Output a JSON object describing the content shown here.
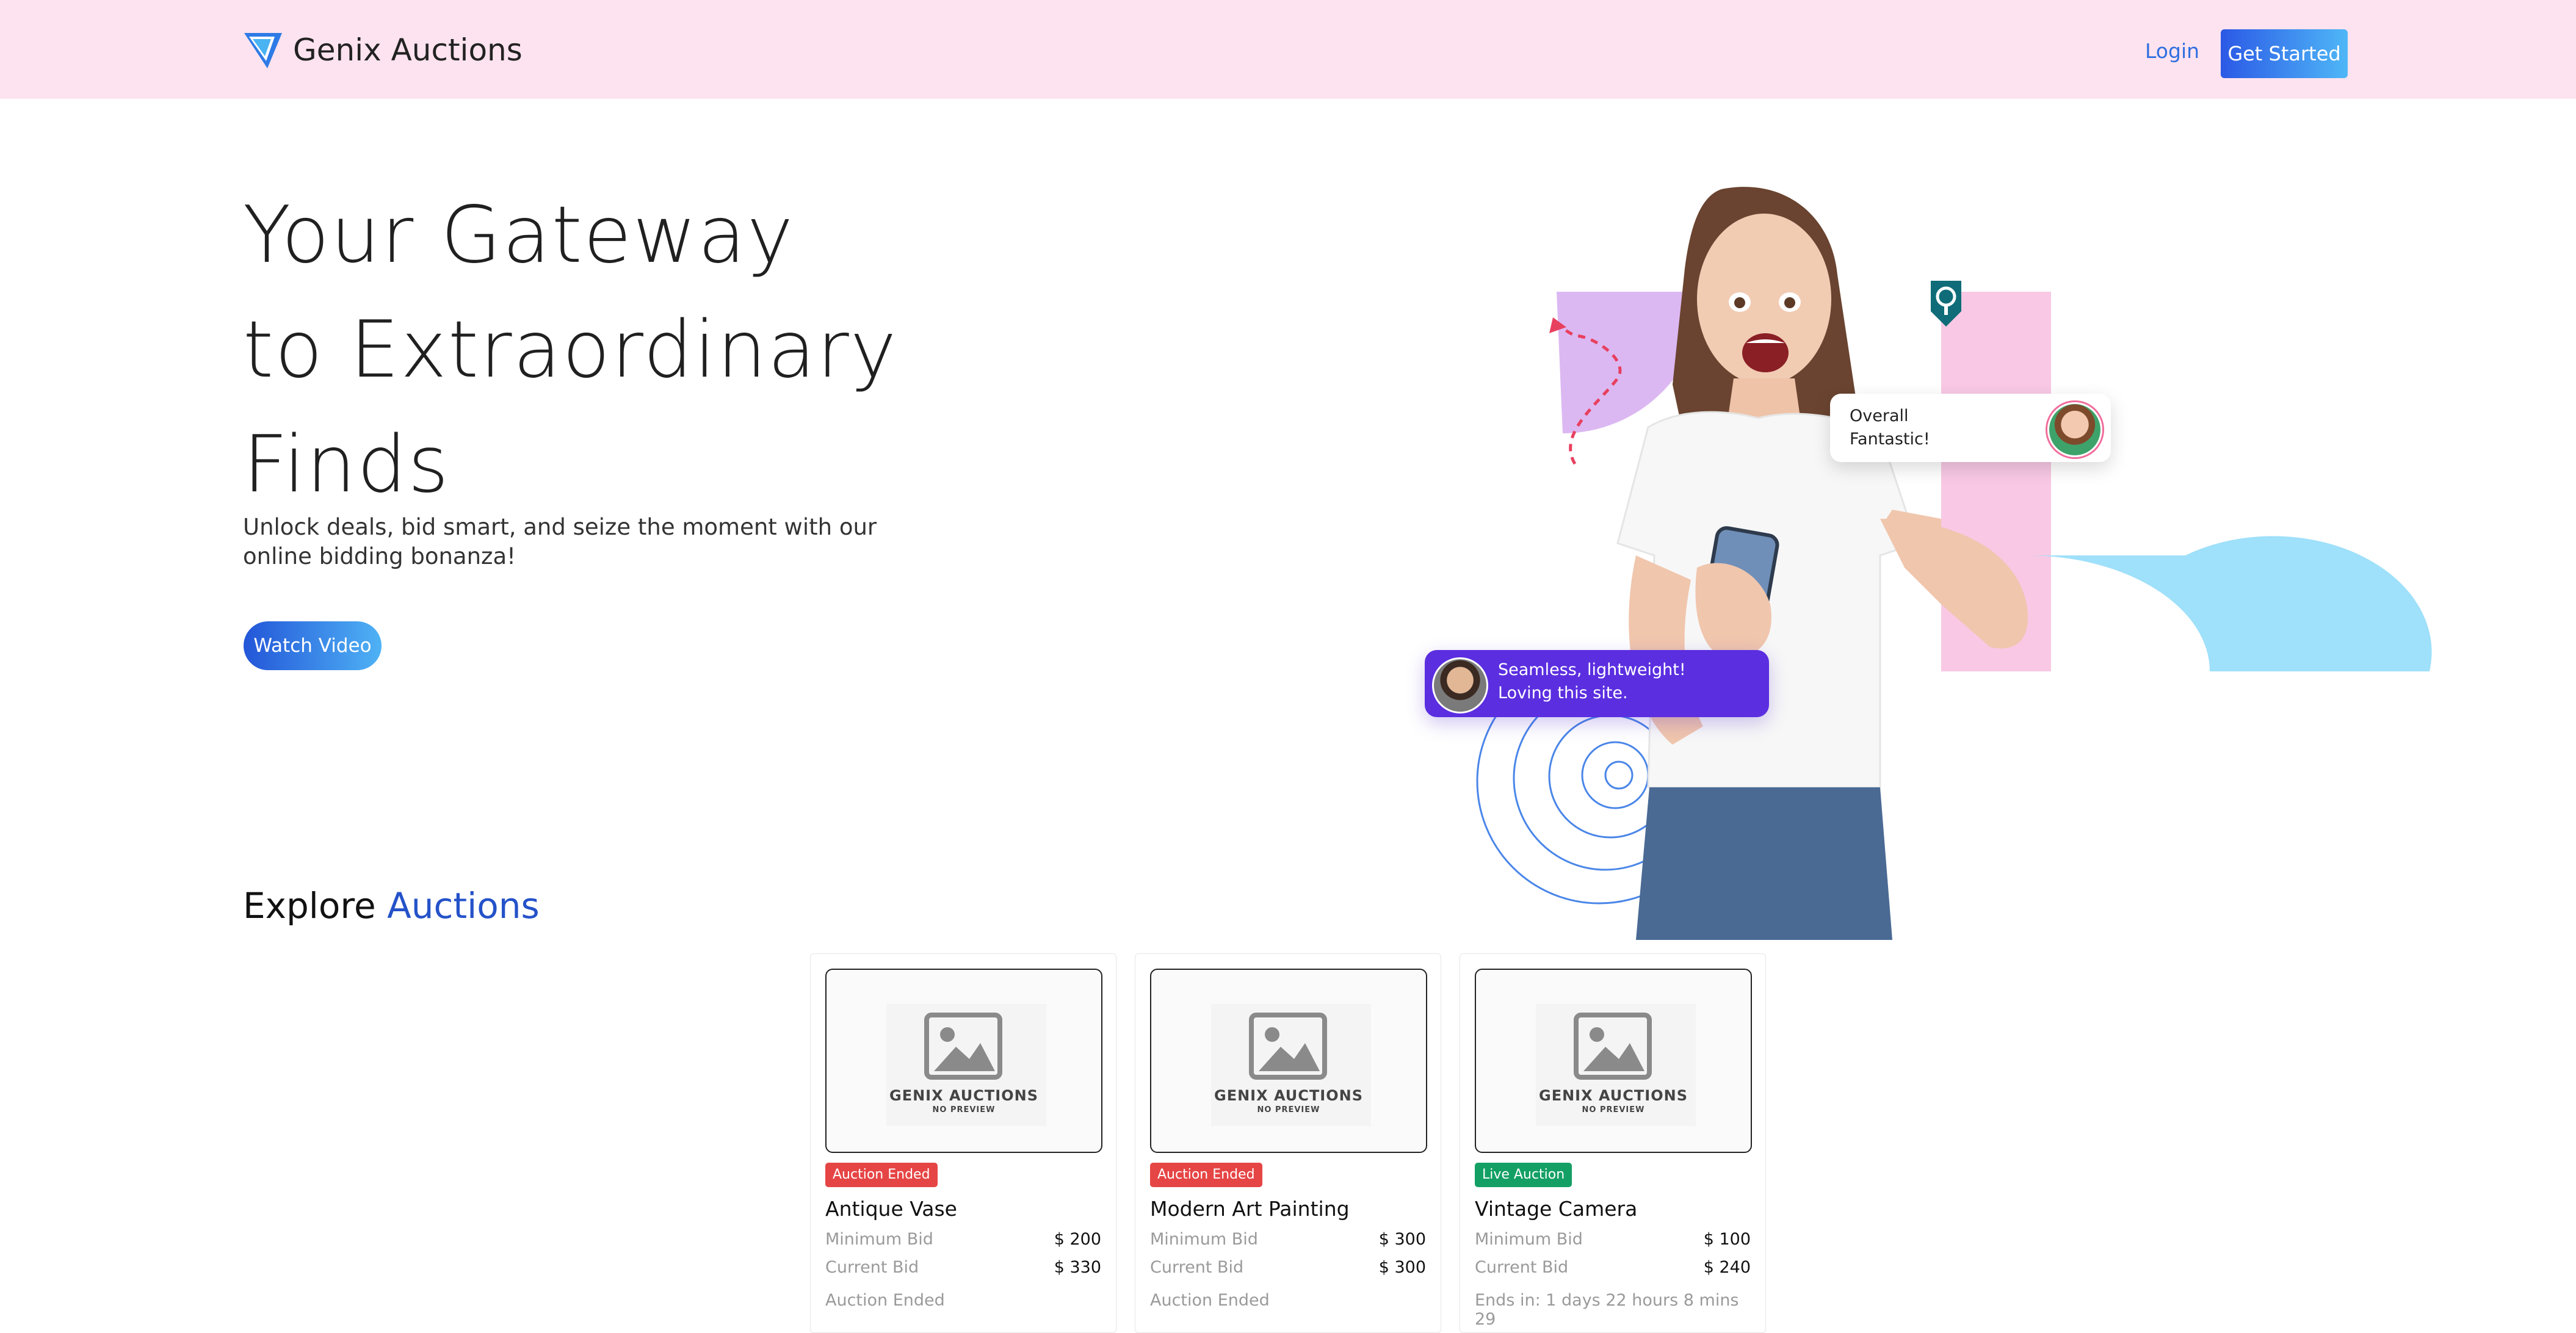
{
  "brand": {
    "name": "Genix Auctions",
    "logo_icon": "triangle-logo-icon"
  },
  "nav": {
    "login": "Login",
    "get_started": "Get Started"
  },
  "hero": {
    "title_lines": [
      "Your Gateway",
      "to Extraordinary",
      "Finds"
    ],
    "subtitle": "Unlock deals, bid smart, and seize the moment with our online bidding bonanza!",
    "watch_video": "Watch Video",
    "bubble_right": [
      "Overall",
      "Fantastic!"
    ],
    "bubble_left": [
      "Seamless, lightweight!",
      "Loving this site."
    ]
  },
  "explore": {
    "prefix": "Explore",
    "accent": "Auctions"
  },
  "placeholder": {
    "brand": "GENIX AUCTIONS",
    "sub": "NO PREVIEW"
  },
  "cards": [
    {
      "status": "Auction Ended",
      "badge_type": "ended",
      "title": "Antique Vase",
      "min_label": "Minimum Bid",
      "min_value": "$ 200",
      "cur_label": "Current Bid",
      "cur_value": "$ 330",
      "footer": "Auction Ended"
    },
    {
      "status": "Auction Ended",
      "badge_type": "ended",
      "title": "Modern Art Painting",
      "min_label": "Minimum Bid",
      "min_value": "$ 300",
      "cur_label": "Current Bid",
      "cur_value": "$ 300",
      "footer": "Auction Ended"
    },
    {
      "status": "Live Auction",
      "badge_type": "live",
      "title": "Vintage Camera",
      "min_label": "Minimum Bid",
      "min_value": "$ 100",
      "cur_label": "Current Bid",
      "cur_value": "$ 240",
      "footer": "Ends in: 1 days 22 hours 8 mins 29"
    }
  ],
  "colors": {
    "nav_bg": "#fde3ef",
    "accent": "#2452c9",
    "ended": "#e64545",
    "live": "#14a065",
    "bubble_purple": "#5b2ee0"
  }
}
